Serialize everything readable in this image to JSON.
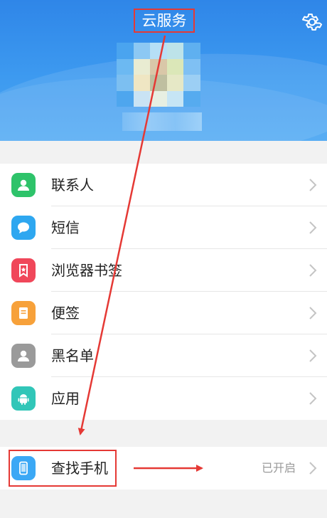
{
  "header": {
    "title": "云服务",
    "gradient_top": "#2f86e8",
    "gradient_bottom": "#4aa6f2"
  },
  "menu": {
    "items": [
      {
        "label": "联系人",
        "icon": "contacts-icon",
        "color": "#2ec36a"
      },
      {
        "label": "短信",
        "icon": "message-icon",
        "color": "#2ea7f0"
      },
      {
        "label": "浏览器书签",
        "icon": "bookmark-icon",
        "color": "#f0475a"
      },
      {
        "label": "便签",
        "icon": "note-icon",
        "color": "#f7a13a"
      },
      {
        "label": "黑名单",
        "icon": "blacklist-icon",
        "color": "#9a9a9a"
      },
      {
        "label": "应用",
        "icon": "android-icon",
        "color": "#31c6b8"
      }
    ]
  },
  "find_phone": {
    "label": "查找手机",
    "status": "已开启",
    "icon": "phone-icon",
    "color": "#3ba8f5"
  },
  "annotation": {
    "highlight_color": "#e53935"
  }
}
